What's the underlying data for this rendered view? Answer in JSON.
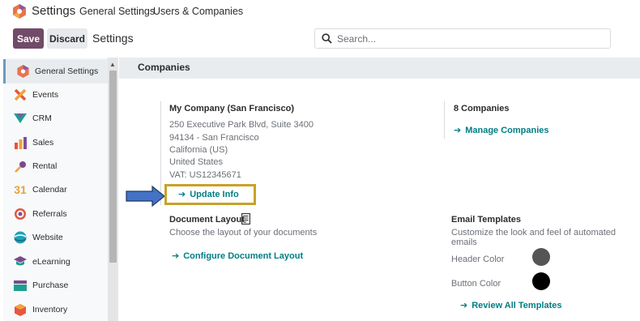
{
  "topnav": {
    "app_title": "Settings",
    "links": [
      "General Settings",
      "Users & Companies"
    ]
  },
  "controls": {
    "save_label": "Save",
    "discard_label": "Discard",
    "title": "Settings",
    "search_placeholder": "Search..."
  },
  "sidebar": {
    "items": [
      {
        "label": "General Settings",
        "icon": "odoo-logo-icon",
        "active": true
      },
      {
        "label": "Events",
        "icon": "events-icon"
      },
      {
        "label": "CRM",
        "icon": "crm-icon"
      },
      {
        "label": "Sales",
        "icon": "sales-icon"
      },
      {
        "label": "Rental",
        "icon": "rental-icon"
      },
      {
        "label": "Calendar",
        "icon": "calendar-icon",
        "glyph": "31"
      },
      {
        "label": "Referrals",
        "icon": "referrals-icon"
      },
      {
        "label": "Website",
        "icon": "website-icon"
      },
      {
        "label": "eLearning",
        "icon": "elearning-icon"
      },
      {
        "label": "Purchase",
        "icon": "purchase-icon"
      },
      {
        "label": "Inventory",
        "icon": "inventory-icon"
      }
    ]
  },
  "section": {
    "title": "Companies"
  },
  "company": {
    "name": "My Company (San Francisco)",
    "address_lines": [
      "250 Executive Park Blvd, Suite 3400",
      "94134 - San Francisco",
      "California (US)",
      "United States",
      "VAT:  US12345671"
    ],
    "update_label": "Update Info"
  },
  "companies": {
    "count_label": "8 Companies",
    "manage_label": "Manage Companies"
  },
  "document_layout": {
    "title": "Document Layout",
    "description": "Choose the layout of your documents",
    "link_label": "Configure Document Layout"
  },
  "email_templates": {
    "title": "Email Templates",
    "description": "Customize the look and feel of automated emails",
    "header_color_label": "Header Color",
    "button_color_label": "Button Color",
    "review_label": "Review All Templates",
    "header_color": "#555555",
    "button_color": "#000000"
  },
  "colors": {
    "brand": "#714b67",
    "link": "#017e84",
    "highlight": "#c9a227",
    "annotation_arrow": "#4472c4"
  }
}
